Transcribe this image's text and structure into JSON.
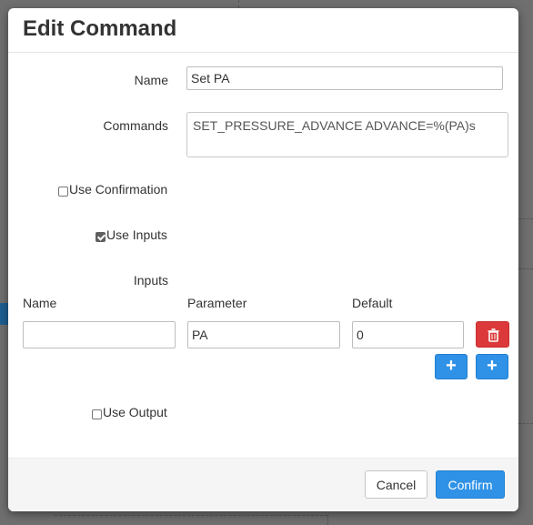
{
  "dialog": {
    "title": "Edit Command",
    "name_label": "Name",
    "name_value": "Set PA",
    "commands_label": "Commands",
    "commands_value": "SET_PRESSURE_ADVANCE ADVANCE=%(PA)s",
    "use_confirmation": {
      "label": "Use Confirmation",
      "checked": false
    },
    "use_inputs": {
      "label": "Use Inputs",
      "checked": true
    },
    "inputs_label": "Inputs",
    "inputs_table": {
      "headers": [
        "Name",
        "Parameter",
        "Default"
      ],
      "rows": [
        {
          "name": "",
          "parameter": "PA",
          "default": "0"
        }
      ]
    },
    "add_icon_text": "+",
    "use_output": {
      "label": "Use Output",
      "checked": false
    },
    "cancel_label": "Cancel",
    "confirm_label": "Confirm"
  },
  "colors": {
    "primary": "#2f92e6",
    "danger": "#dc3a3a",
    "overlay": "#6f6f6f"
  },
  "icons": [
    "trash-icon",
    "plus-icon",
    "checkbox-checked-icon"
  ]
}
